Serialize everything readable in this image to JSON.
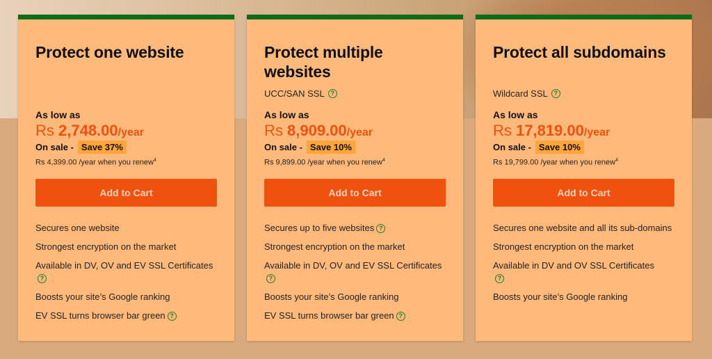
{
  "cards": [
    {
      "title": "Protect one website",
      "subtitle": "",
      "as_low_as": "As low as",
      "currency": "Rs ",
      "amount": "2,748.00",
      "period": "/year",
      "sale_label": "On sale -",
      "save_badge": "Save 37%",
      "renew_text": "Rs 4,399.00 /year when you renew",
      "renew_footnote": "4",
      "button": "Add to Cart",
      "features": [
        {
          "text": "Secures one website",
          "help": false
        },
        {
          "text": "Strongest encryption on the market",
          "help": false
        },
        {
          "text": "Available in DV, OV and EV SSL Certificates",
          "help": true
        },
        {
          "text": "Boosts your site’s Google ranking",
          "help": false
        },
        {
          "text": "EV SSL turns browser bar green",
          "help": true
        }
      ]
    },
    {
      "title": "Protect multiple websites",
      "subtitle": "UCC/SAN SSL",
      "as_low_as": "As low as",
      "currency": "Rs ",
      "amount": "8,909.00",
      "period": "/year",
      "sale_label": "On sale -",
      "save_badge": "Save 10%",
      "renew_text": "Rs 9,899.00 /year when you renew",
      "renew_footnote": "4",
      "button": "Add to Cart",
      "features": [
        {
          "text": "Secures up to five websites",
          "help": true
        },
        {
          "text": "Strongest encryption on the market",
          "help": false
        },
        {
          "text": "Available in DV, OV and EV SSL Certificates",
          "help": true
        },
        {
          "text": "Boosts your site’s Google ranking",
          "help": false
        },
        {
          "text": "EV SSL turns browser bar green",
          "help": true
        }
      ]
    },
    {
      "title": "Protect all subdomains",
      "subtitle": "Wildcard SSL",
      "as_low_as": "As low as",
      "currency": "Rs ",
      "amount": "17,819.00",
      "period": "/year",
      "sale_label": "On sale -",
      "save_badge": "Save 10%",
      "renew_text": "Rs 19,799.00 /year when you renew",
      "renew_footnote": "4",
      "button": "Add to Cart",
      "features": [
        {
          "text": "Secures one website and all its sub-domains",
          "help": false
        },
        {
          "text": "Strongest encryption on the market",
          "help": false
        },
        {
          "text": "Available in DV and OV SSL Certificates",
          "help": true
        },
        {
          "text": "Boosts your site’s Google ranking",
          "help": false
        }
      ]
    }
  ],
  "help_glyph": "?",
  "colors": {
    "accent_orange": "#f0510e",
    "card_bg": "#ffb97a",
    "top_border_green": "#0d6b1a",
    "badge_bg": "#ffa53a",
    "help_green": "#1f7a2a"
  }
}
